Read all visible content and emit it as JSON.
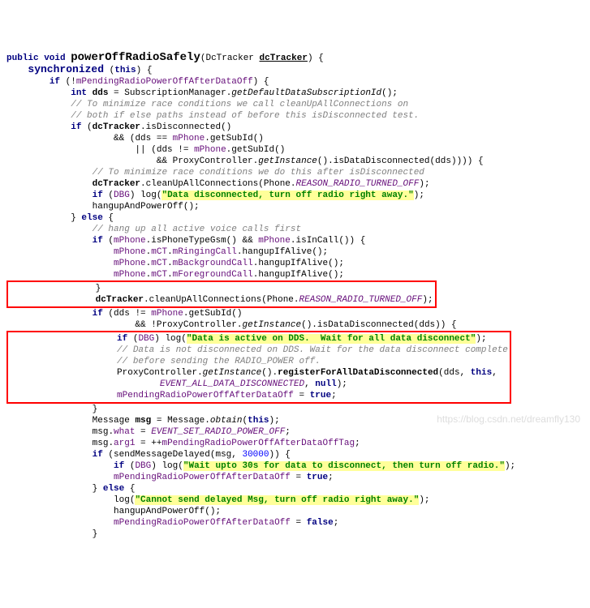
{
  "sig": {
    "mod": "public void",
    "name": "powerOffRadioSafely",
    "ptype": "DcTracker",
    "pname": "dcTracker"
  },
  "sync": "synchronized",
  "this": "this",
  "f_pending": "mPendingRadioPowerOffAfterDataOff",
  "int": "int",
  "dds": "dds",
  "subMgr": "SubscriptionManager",
  "getDDS": "getDefaultDataSubscriptionId",
  "c1": "// To minimize race conditions we call cleanUpAllConnections on",
  "c2": "// both if else paths instead of before this isDisconnected test.",
  "if": "if",
  "else": "else",
  "dcTracker": "dcTracker",
  "isDisc": "isDisconnected",
  "mPhone": "mPhone",
  "getSubId": "getSubId",
  "proxyCtl": "ProxyController",
  "getInst": "getInstance",
  "isDataDisc": "isDataDisconnected",
  "c3": "// To minimize race conditions we do this after isDisconnected",
  "cleanUp": "cleanUpAllConnections",
  "phoneCls": "Phone",
  "reason": "REASON_RADIO_TURNED_OFF",
  "DBG": "DBG",
  "log": "log",
  "s1": "\"Data disconnected, turn off radio right away.\"",
  "hangupPO": "hangupAndPowerOff",
  "c4": "// hang up all active voice calls first",
  "isGsm": "isPhoneTypeGsm",
  "isInCall": "isInCall",
  "mCT": "mCT",
  "mRing": "mRingingCall",
  "mBg": "mBackgroundCall",
  "mFg": "mForegroundCall",
  "hangupIA": "hangupIfAlive",
  "s2": "\"Data is active on DDS.  Wait for all data disconnect\"",
  "c5": "// Data is not disconnected on DDS. Wait for the data disconnect complete",
  "c6": "// before sending the RADIO_POWER off.",
  "regAll": "registerForAllDataDisconnected",
  "evAll": "EVENT_ALL_DATA_DISCONNECTED",
  "null": "null",
  "true": "true",
  "false": "false",
  "Message": "Message",
  "msg": "msg",
  "obtain": "obtain",
  "what": "what",
  "evSet": "EVENT_SET_RADIO_POWER_OFF",
  "arg1": "arg1",
  "tag": "mPendingRadioPowerOffAfterDataOffTag",
  "sendDelayed": "sendMessageDelayed",
  "n30000": "30000",
  "s3": "\"Wait upto 30s for data to disconnect, then turn off radio.\"",
  "s4": "\"Cannot send delayed Msg, turn off radio right away.\"",
  "watermark": "https://blog.csdn.net/dreamfly130"
}
